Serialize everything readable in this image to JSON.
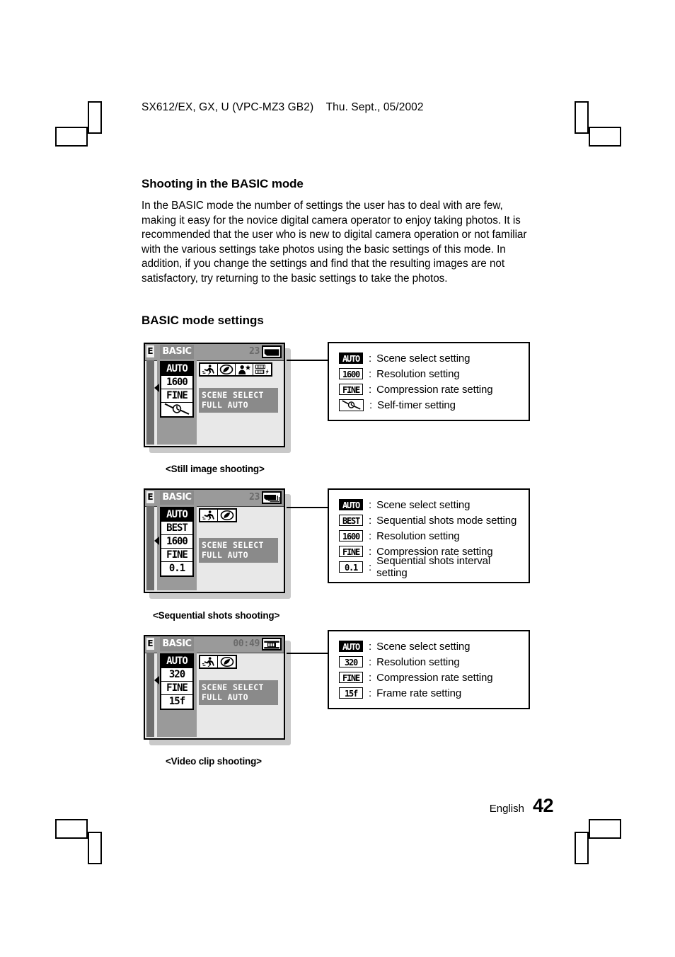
{
  "header": {
    "text": "SX612/EX, GX, U (VPC-MZ3 GB2)    Thu. Sept., 05/2002"
  },
  "content": {
    "section_title": "Shooting in the BASIC mode",
    "body": "In the BASIC mode the number of settings the user has to deal with are few, making it easy for the novice digital camera operator to enjoy taking photos. It is recommended that the user who is new to digital camera operation or not familiar with the various settings take photos using the basic settings of this mode. In addition, if you change the settings and find that the resulting images are not satisfactory, try returning to the basic settings to take the photos.",
    "sub_title": "BASIC mode settings"
  },
  "figures": [
    {
      "caption": "<Still image shooting>",
      "lcd": {
        "exposure_marker": "E",
        "mode_label": "BASIC",
        "counter": "23",
        "media_icon": "single-frame-card-icon",
        "settings": [
          "AUTO",
          "1600",
          "FINE",
          "self-timer-icon"
        ],
        "settings_inverted_index": 0,
        "scene_icons": [
          "sports-icon",
          "landscape-leaf-icon",
          "night-portrait-icon",
          "film-flash-icon"
        ],
        "banner_line1": "SCENE SELECT",
        "banner_line2": "FULL AUTO"
      },
      "legend": [
        {
          "chip": "AUTO",
          "inverted": true,
          "text": "Scene select setting"
        },
        {
          "chip": "1600",
          "inverted": false,
          "text": "Resolution setting"
        },
        {
          "chip": "FINE",
          "inverted": false,
          "text": "Compression rate setting"
        },
        {
          "chip": "timer",
          "inverted": false,
          "text": "Self-timer setting"
        }
      ]
    },
    {
      "caption": "<Sequential shots shooting>",
      "lcd": {
        "exposure_marker": "E",
        "mode_label": "BASIC",
        "counter": "23",
        "media_icon": "stacked-frames-icon",
        "settings": [
          "AUTO",
          "BEST",
          "1600",
          "FINE",
          "0.1"
        ],
        "settings_inverted_index": 0,
        "scene_icons": [
          "sports-icon",
          "landscape-leaf-icon"
        ],
        "banner_line1": "SCENE SELECT",
        "banner_line2": "FULL AUTO"
      },
      "legend": [
        {
          "chip": "AUTO",
          "inverted": true,
          "text": "Scene select setting"
        },
        {
          "chip": "BEST",
          "inverted": false,
          "text": "Sequential shots mode setting"
        },
        {
          "chip": "1600",
          "inverted": false,
          "text": "Resolution setting"
        },
        {
          "chip": "FINE",
          "inverted": false,
          "text": "Compression rate setting"
        },
        {
          "chip": "0.1",
          "inverted": false,
          "text": "Sequential shots interval setting"
        }
      ]
    },
    {
      "caption": "<Video clip shooting>",
      "lcd": {
        "exposure_marker": "E",
        "mode_label": "BASIC",
        "counter": "00:49",
        "media_icon": "film-strip-icon",
        "settings": [
          "AUTO",
          "320",
          "FINE",
          "15f"
        ],
        "settings_inverted_index": 0,
        "scene_icons": [
          "sports-icon",
          "landscape-leaf-icon"
        ],
        "banner_line1": "SCENE SELECT",
        "banner_line2": "FULL AUTO"
      },
      "legend": [
        {
          "chip": "AUTO",
          "inverted": true,
          "text": "Scene select setting"
        },
        {
          "chip": "320",
          "inverted": false,
          "text": "Resolution setting"
        },
        {
          "chip": "FINE",
          "inverted": false,
          "text": "Compression rate setting"
        },
        {
          "chip": "15f",
          "inverted": false,
          "text": "Frame rate setting"
        }
      ]
    }
  ],
  "footer": {
    "language": "English",
    "page_number": "42"
  }
}
